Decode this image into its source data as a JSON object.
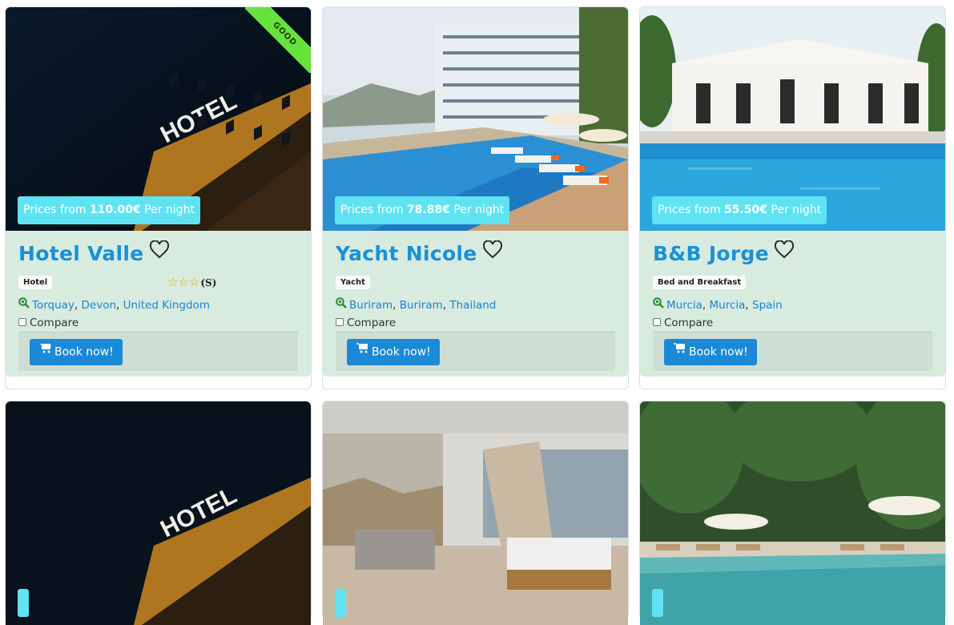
{
  "ribbon": "GOOD",
  "price_prefix": "Prices from",
  "price_suffix": "Per night",
  "compare_label": "Compare",
  "book_label": "Book now!",
  "cards": [
    {
      "name": "Hotel Valle",
      "price": "110.00€",
      "type": "Hotel",
      "stars_count": "(S)",
      "city": "Torquay",
      "region": "Devon",
      "country": "United Kingdom",
      "rating_stars": 0
    },
    {
      "name": "Yacht Nicole",
      "price": "78.88€",
      "type": "Yacht",
      "city": "Buriram",
      "region": "Buriram",
      "country": "Thailand"
    },
    {
      "name": "B&B Jorge",
      "price": "55.50€",
      "type": "Bed and Breakfast",
      "city": "Murcia",
      "region": "Murcia",
      "country": "Spain"
    }
  ],
  "colors": {
    "title": "#1a90d8",
    "price_bg": "#5fe3f3",
    "card_body": "#d8ebdf",
    "button": "#1a8ad8",
    "ribbon": "#66e23d"
  },
  "icons": [
    "heart-icon",
    "map-search-icon",
    "cart-icon",
    "star-outline-icon"
  ]
}
